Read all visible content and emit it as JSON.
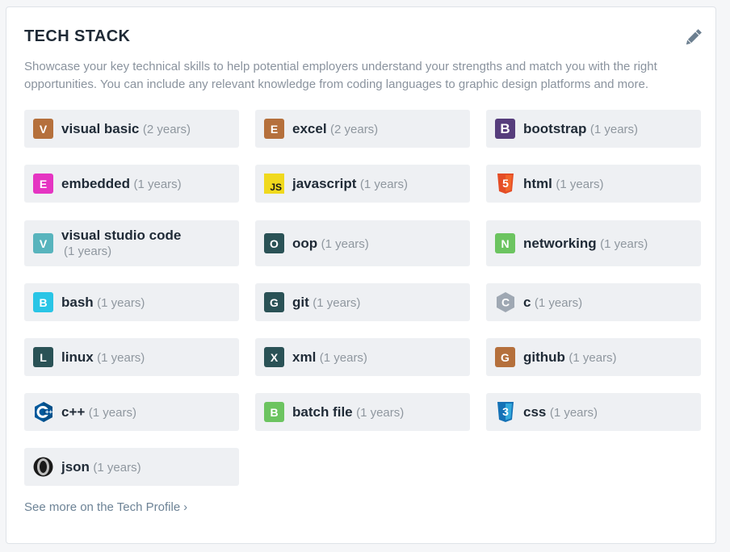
{
  "card": {
    "title": "TECH STACK",
    "description": "Showcase your key technical skills to help potential employers understand your strengths and match you with the right opportunities. You can include any relevant knowledge from coding languages to graphic design platforms and more.",
    "edit_icon": "pencil-icon",
    "footer_link": "See more on the Tech Profile",
    "footer_chevron": "›"
  },
  "skills": [
    {
      "name": "visual basic",
      "years": "(2 years)",
      "icon": "letter-v",
      "letter": "V",
      "color": "#b5703c"
    },
    {
      "name": "excel",
      "years": "(2 years)",
      "icon": "letter-e",
      "letter": "E",
      "color": "#b5703c"
    },
    {
      "name": "bootstrap",
      "years": "(1 years)",
      "icon": "bootstrap-icon",
      "letter": "B",
      "color": "#563d7c"
    },
    {
      "name": "embedded",
      "years": "(1 years)",
      "icon": "letter-e",
      "letter": "E",
      "color": "#e535c2"
    },
    {
      "name": "javascript",
      "years": "(1 years)",
      "icon": "javascript-icon",
      "letter": "JS",
      "color": "#f0d91d"
    },
    {
      "name": "html",
      "years": "(1 years)",
      "icon": "html5-icon",
      "letter": "5",
      "color": "#e44d26"
    },
    {
      "name": "visual studio code",
      "years": "(1 years)",
      "icon": "letter-v",
      "letter": "V",
      "color": "#58b4bd"
    },
    {
      "name": "oop",
      "years": "(1 years)",
      "icon": "letter-o",
      "letter": "O",
      "color": "#2a5256"
    },
    {
      "name": "networking",
      "years": "(1 years)",
      "icon": "letter-n",
      "letter": "N",
      "color": "#6cc460"
    },
    {
      "name": "bash",
      "years": "(1 years)",
      "icon": "letter-b",
      "letter": "B",
      "color": "#29c5e6"
    },
    {
      "name": "git",
      "years": "(1 years)",
      "icon": "letter-g",
      "letter": "G",
      "color": "#2a5256"
    },
    {
      "name": "c",
      "years": "(1 years)",
      "icon": "c-hexagon-icon",
      "letter": "C",
      "color": "#9fa8b3"
    },
    {
      "name": "linux",
      "years": "(1 years)",
      "icon": "letter-l",
      "letter": "L",
      "color": "#2a5256"
    },
    {
      "name": "xml",
      "years": "(1 years)",
      "icon": "letter-x",
      "letter": "X",
      "color": "#2a5256"
    },
    {
      "name": "github",
      "years": "(1 years)",
      "icon": "letter-g",
      "letter": "G",
      "color": "#b5703c"
    },
    {
      "name": "c++",
      "years": "(1 years)",
      "icon": "cpp-hexagon-icon",
      "letter": "C",
      "color": "#00599c"
    },
    {
      "name": "batch file",
      "years": "(1 years)",
      "icon": "letter-b",
      "letter": "B",
      "color": "#6cc460"
    },
    {
      "name": "css",
      "years": "(1 years)",
      "icon": "css3-icon",
      "letter": "3",
      "color": "#1572b6"
    },
    {
      "name": "json",
      "years": "(1 years)",
      "icon": "json-icon",
      "letter": "",
      "color": "#222222"
    }
  ]
}
